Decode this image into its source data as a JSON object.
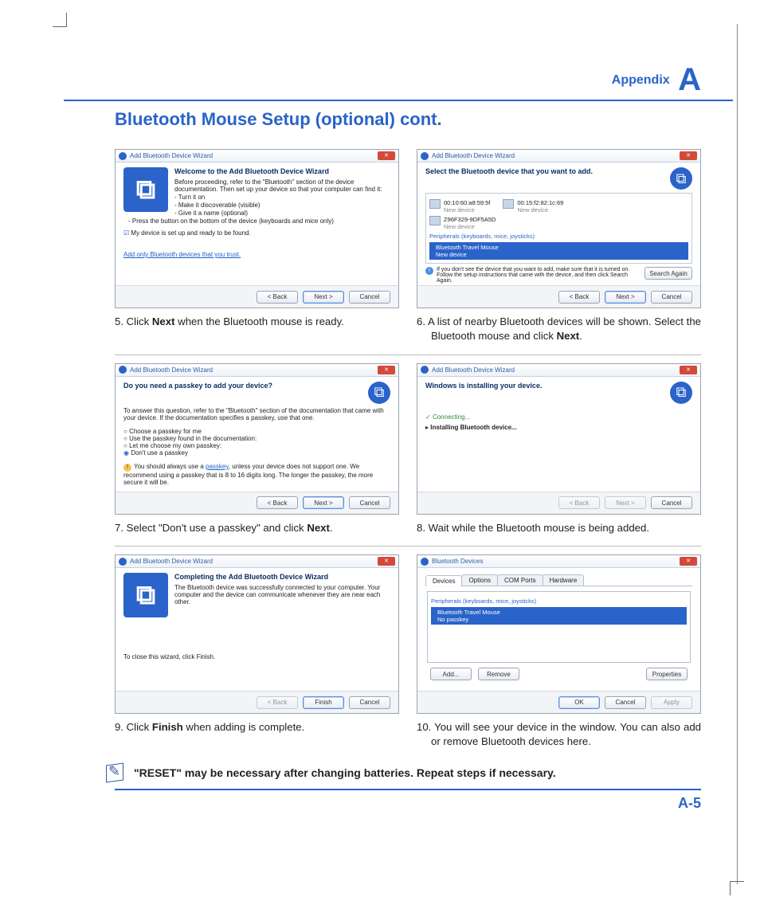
{
  "header": {
    "appendix": "Appendix",
    "letter": "A"
  },
  "title": "Bluetooth Mouse Setup (optional) cont.",
  "page_number": "A-5",
  "note": "\"RESET\" may be necessary after changing batteries. Repeat steps if necessary.",
  "buttons": {
    "back": "< Back",
    "next": "Next >",
    "cancel": "Cancel",
    "finish": "Finish",
    "search_again": "Search Again",
    "add": "Add...",
    "remove": "Remove",
    "properties": "Properties",
    "ok": "OK",
    "apply": "Apply"
  },
  "wizard_title": "Add Bluetooth Device Wizard",
  "step5": {
    "heading": "Welcome to the Add Bluetooth Device Wizard",
    "intro": "Before proceeding, refer to the \"Bluetooth\" section of the device documentation. Then set up your device so that your computer can find it:",
    "bullets": [
      "- Turn it on",
      "- Make it discoverable (visible)",
      "- Give it a name (optional)",
      "- Press the button on the bottom of the device (keyboards and mice only)"
    ],
    "checkbox": "My device is set up and ready to be found.",
    "link": "Add only Bluetooth devices that you trust.",
    "caption_prefix": "5.   Click ",
    "caption_bold": "Next",
    "caption_suffix": " when the Bluetooth mouse is ready."
  },
  "step6": {
    "heading": "Select the Bluetooth device that you want to add.",
    "dev1_mac": "00:10:60:a8:59:5f",
    "dev1_sub": "New device",
    "dev2_mac": "00:15:f2:82:1c:69",
    "dev2_sub": "New device",
    "dev3_name": "Z96F329-9DF5A5D",
    "dev3_sub": "New device",
    "periph": "Peripherals (keyboards, mice, joysticks)",
    "sel_name": "Bluetooth Travel Mouse",
    "sel_sub": "New device",
    "info": "If you don't see the device that you want to add, make sure that it is turned on. Follow the setup instructions that came with the device, and then click Search Again.",
    "caption_prefix": "6.   A list of nearby Bluetooth devices will be shown. Select the Bluetooth mouse and click ",
    "caption_bold": "Next",
    "caption_suffix": "."
  },
  "step7": {
    "heading": "Do you need a passkey to add your device?",
    "intro": "To answer this question, refer to the \"Bluetooth\" section of the documentation that came with your device. If the documentation specifies a passkey, use that one.",
    "r1": "Choose a passkey for me",
    "r2": "Use the passkey found in the documentation:",
    "r3": "Let me choose my own passkey:",
    "r4": "Don't use a passkey",
    "warn": "You should always use a passkey, unless your device does not support one. We recommend using a passkey that is 8 to 16 digits long. The longer the passkey, the more secure it will be.",
    "warn_link": "passkey",
    "caption_prefix": "7.   Select \"Don't use a passkey\" and click ",
    "caption_bold": "Next",
    "caption_suffix": "."
  },
  "step8": {
    "heading": "Windows is installing your device.",
    "line1": "Connecting...",
    "line2": "Installing Bluetooth device...",
    "caption": "8.   Wait while the Bluetooth mouse is being added."
  },
  "step9": {
    "heading": "Completing the Add Bluetooth Device Wizard",
    "intro": "The Bluetooth device was successfully connected to your computer. Your computer and the device can communicate whenever they are near each other.",
    "close": "To close this wizard, click Finish.",
    "caption_prefix": "9.   Click ",
    "caption_bold": "Finish",
    "caption_suffix": " when adding is complete."
  },
  "step10": {
    "title": "Bluetooth Devices",
    "tabs": [
      "Devices",
      "Options",
      "COM Ports",
      "Hardware"
    ],
    "periph": "Peripherals (keyboards, mice, joysticks)",
    "sel_name": "Bluetooth Travel Mouse",
    "sel_sub": "No passkey",
    "caption": "10. You will see your device in the window. You can also add or remove Bluetooth devices here."
  }
}
